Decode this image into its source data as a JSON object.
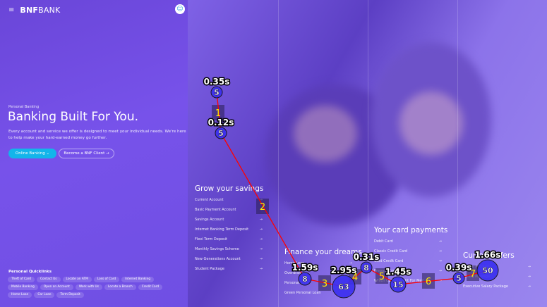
{
  "header": {
    "logo_bold": "BNF",
    "logo_light": "BANK",
    "menu_icon": "≡",
    "help_icon": "☺"
  },
  "hero": {
    "kicker": "Personal Banking",
    "title": "Banking Built For You.",
    "description": "Every account and service we offer is designed to meet your individual needs. We're here to help make your hard-earned money go further.",
    "primary_button": "Online Banking ⌄",
    "secondary_button": "Become a BNF Client →"
  },
  "quicklinks": {
    "title": "Personal Quicklinks",
    "items": [
      "Theft of Card",
      "Contact Us",
      "Locate an ATM",
      "Loss of Card",
      "Internet Banking",
      "Mobile Banking",
      "Open an Account",
      "Work with Us",
      "Locate a Branch",
      "Credit Card",
      "Home Loan",
      "Car Loan",
      "Term Deposit"
    ]
  },
  "sections": [
    {
      "title": "Grow your savings",
      "items": [
        "Current Account",
        "Basic Payment Account",
        "Savings Account",
        "Internet Banking Term Deposit",
        "Flexi Term Deposit",
        "Monthly Savings Scheme",
        "New Generations Account",
        "Student Package"
      ]
    },
    {
      "title": "Finance your dreams",
      "items": [
        "Home Loan",
        "Overdraft",
        "Personal Loan",
        "Green Personal Loan"
      ]
    },
    {
      "title": "Your card payments",
      "items": [
        "Debit Card",
        "Classic Credit Card",
        "Gold Credit Card",
        "Prepaid Card",
        "Which Card Is Right For Me?"
      ]
    },
    {
      "title": "Current offers",
      "items": [
        "Salary Account",
        "Salary Package",
        "Executive Salary Package"
      ]
    }
  ],
  "arrow": "→",
  "gaze": {
    "color_fixation": "#3a2ff0",
    "color_path": "#ff0000",
    "color_step": "#ffee00",
    "fixations": [
      {
        "count": "5",
        "duration": "0.35s"
      },
      {
        "count": "5",
        "duration": "0.12s"
      },
      {
        "count": "8",
        "duration": "1.59s"
      },
      {
        "count": "63",
        "duration": "2.95s"
      },
      {
        "count": "8",
        "duration": "0.31s"
      },
      {
        "count": "15",
        "duration": "1.45s"
      },
      {
        "count": "5",
        "duration": "0.39s"
      },
      {
        "count": "50",
        "duration": "1.66s"
      }
    ],
    "steps": [
      "1",
      "2",
      "3",
      "4",
      "5",
      "6",
      "7"
    ]
  }
}
